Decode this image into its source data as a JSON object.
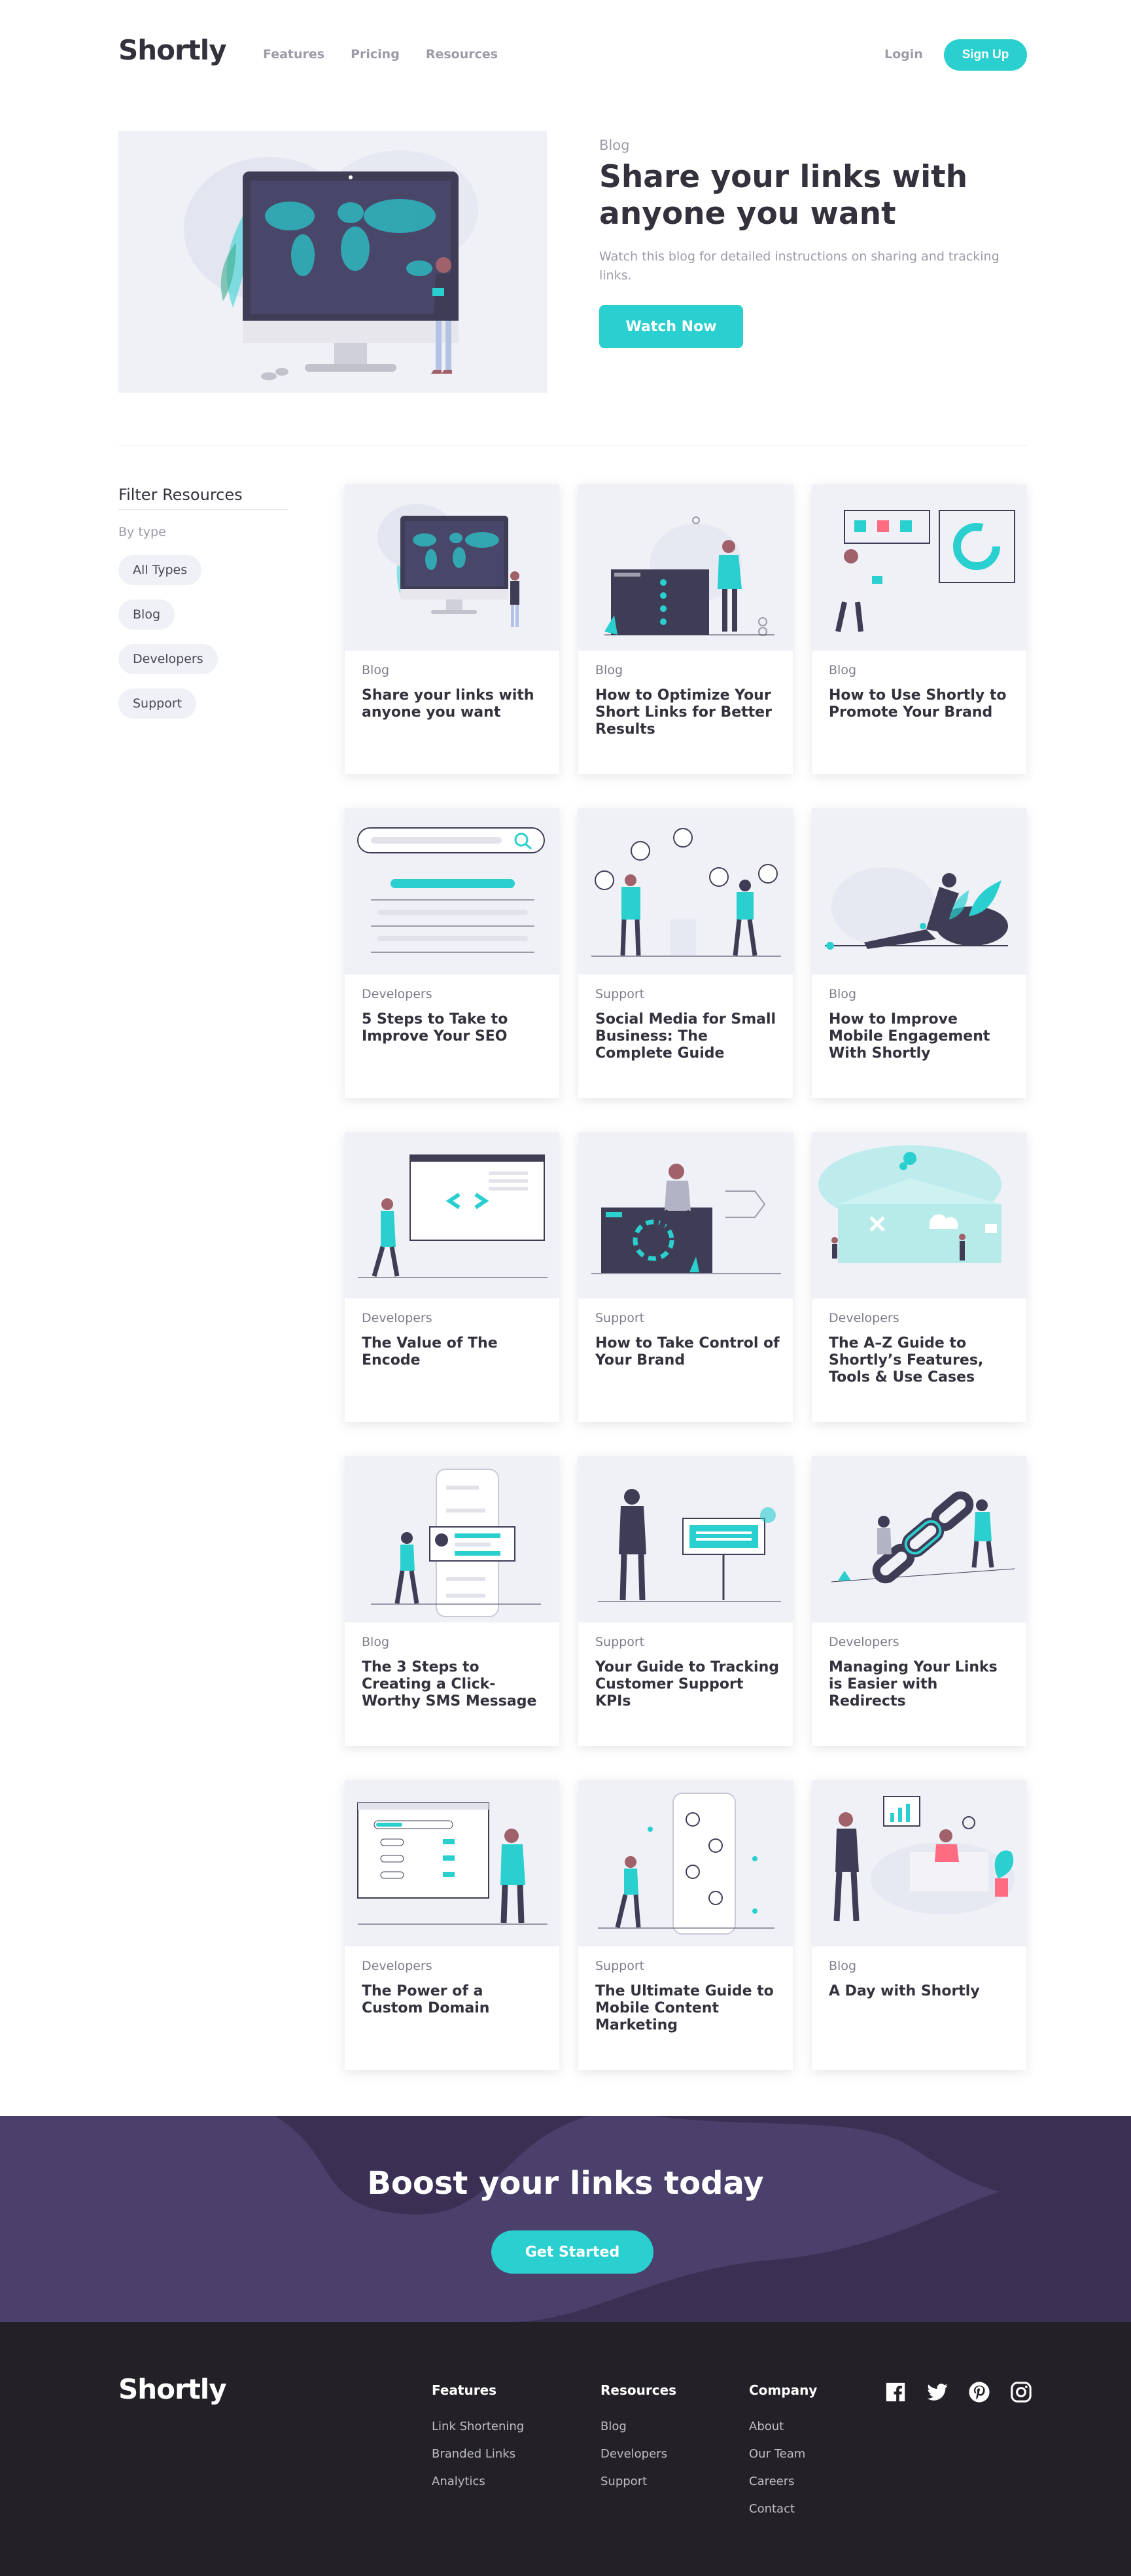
{
  "header": {
    "logo": "Shortly",
    "nav": [
      "Features",
      "Pricing",
      "Resources"
    ],
    "login": "Login",
    "signup": "Sign Up"
  },
  "hero": {
    "tag": "Blog",
    "title": "Share your links with anyone you want",
    "subtitle": "Watch this blog for detailed instructions on sharing and tracking links.",
    "cta": "Watch Now"
  },
  "filter": {
    "title": "Filter Resources",
    "by": "By type",
    "chips": [
      "All Types",
      "Blog",
      "Developers",
      "Support"
    ]
  },
  "cards": [
    {
      "category": "Blog",
      "title": "Share your links with anyone you want",
      "illustration": "monitor-map"
    },
    {
      "category": "Blog",
      "title": "How to Optimize Your Short Links for Better Results",
      "illustration": "woman-board"
    },
    {
      "category": "Blog",
      "title": "How to Use Shortly to Promote Your Brand",
      "illustration": "man-charts"
    },
    {
      "category": "Developers",
      "title": "5 Steps to Take to Improve Your SEO",
      "illustration": "search-lines"
    },
    {
      "category": "Support",
      "title": "Social Media for Small Business: The Complete Guide",
      "illustration": "social-people"
    },
    {
      "category": "Blog",
      "title": "How to Improve Mobile Engagement With Shortly",
      "illustration": "woman-phone"
    },
    {
      "category": "Developers",
      "title": "The Value of The Encode",
      "illustration": "code-window"
    },
    {
      "category": "Support",
      "title": "How to Take Control of Your Brand",
      "illustration": "man-laptop"
    },
    {
      "category": "Developers",
      "title": "The A–Z Guide to Shortly’s Features, Tools & Use Cases",
      "illustration": "cloud-building"
    },
    {
      "category": "Blog",
      "title": "The 3 Steps to Creating a Click-Worthy SMS Message",
      "illustration": "phone-sms"
    },
    {
      "category": "Support",
      "title": "Your Guide to Tracking Customer Support KPIs",
      "illustration": "man-sign"
    },
    {
      "category": "Developers",
      "title": "Managing Your Links is Easier with Redirects",
      "illustration": "chain-links"
    },
    {
      "category": "Developers",
      "title": "The Power of a Custom Domain",
      "illustration": "browser-settings"
    },
    {
      "category": "Support",
      "title": "The Ultimate Guide to Mobile Content Marketing",
      "illustration": "mobile-marketing"
    },
    {
      "category": "Blog",
      "title": "A Day with Shortly",
      "illustration": "office-desk"
    }
  ],
  "boost": {
    "title": "Boost your links today",
    "cta": "Get Started"
  },
  "footer": {
    "logo": "Shortly",
    "columns": [
      {
        "title": "Features",
        "links": [
          "Link Shortening",
          "Branded Links",
          "Analytics"
        ]
      },
      {
        "title": "Resources",
        "links": [
          "Blog",
          "Developers",
          "Support"
        ]
      },
      {
        "title": "Company",
        "links": [
          "About",
          "Our Team",
          "Careers",
          "Contact"
        ]
      }
    ],
    "social": [
      "facebook-icon",
      "twitter-icon",
      "pinterest-icon",
      "instagram-icon"
    ]
  },
  "colors": {
    "accent": "#2acfcf",
    "dark": "#34313d",
    "grey": "#9e9aa8",
    "boost_bg": "#3b3054",
    "footer_bg": "#232127"
  }
}
